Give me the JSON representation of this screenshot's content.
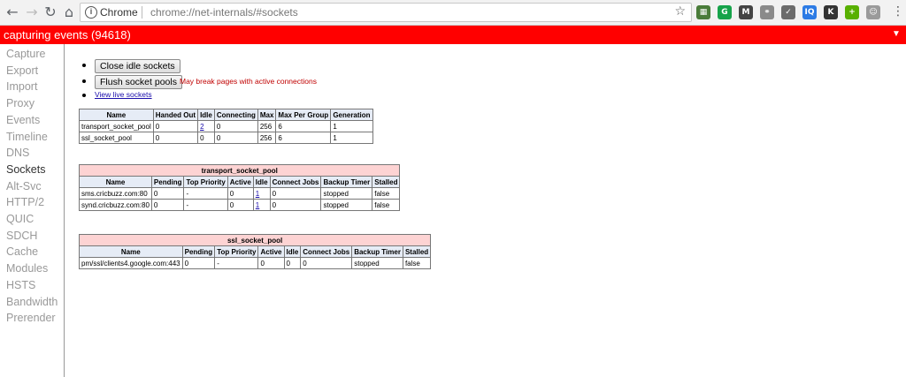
{
  "browser": {
    "omnibox_chip": "Chrome",
    "url": "chrome://net-internals/#sockets",
    "extensions": [
      {
        "name": "camera-extension-icon",
        "glyph": "▦",
        "color": "#4a7c3a"
      },
      {
        "name": "grammarly-icon",
        "glyph": "G",
        "color": "#16a34a"
      },
      {
        "name": "m-extension-icon",
        "glyph": "M",
        "color": "#444444"
      },
      {
        "name": "link-extension-icon",
        "glyph": "⚭",
        "color": "#8a8a8a"
      },
      {
        "name": "check-extension-icon",
        "glyph": "✓",
        "color": "#6b6b6b"
      },
      {
        "name": "iq-extension-icon",
        "glyph": "IQ",
        "color": "#2c7be5"
      },
      {
        "name": "k-extension-icon",
        "glyph": "K",
        "color": "#333333"
      },
      {
        "name": "plus-extension-icon",
        "glyph": "+",
        "color": "#58b000"
      },
      {
        "name": "profile-avatar-icon",
        "glyph": "☺",
        "color": "#9a9a9a"
      }
    ]
  },
  "status": {
    "text": "capturing events (94618)",
    "toggle": "▼"
  },
  "sidebar": {
    "items": [
      {
        "label": "Capture",
        "active": false
      },
      {
        "label": "Export",
        "active": false
      },
      {
        "label": "Import",
        "active": false
      },
      {
        "label": "Proxy",
        "active": false
      },
      {
        "label": "Events",
        "active": false
      },
      {
        "label": "Timeline",
        "active": false
      },
      {
        "label": "DNS",
        "active": false
      },
      {
        "label": "Sockets",
        "active": true
      },
      {
        "label": "Alt-Svc",
        "active": false
      },
      {
        "label": "HTTP/2",
        "active": false
      },
      {
        "label": "QUIC",
        "active": false
      },
      {
        "label": "SDCH",
        "active": false
      },
      {
        "label": "Cache",
        "active": false
      },
      {
        "label": "Modules",
        "active": false
      },
      {
        "label": "HSTS",
        "active": false
      },
      {
        "label": "Bandwidth",
        "active": false
      },
      {
        "label": "Prerender",
        "active": false
      }
    ]
  },
  "actions": {
    "close_idle": "Close idle sockets",
    "flush_pools": "Flush socket pools",
    "flush_warning": "May break pages with active connections",
    "view_live": "View live sockets"
  },
  "pools_table": {
    "headers": [
      "Name",
      "Handed Out",
      "Idle",
      "Connecting",
      "Max",
      "Max Per Group",
      "Generation"
    ],
    "rows": [
      [
        "transport_socket_pool",
        "0",
        "2",
        "0",
        "256",
        "6",
        "1"
      ],
      [
        "ssl_socket_pool",
        "0",
        "0",
        "0",
        "256",
        "6",
        "1"
      ]
    ],
    "link_cells": [
      [
        0,
        2
      ]
    ]
  },
  "transport_pool": {
    "title": "transport_socket_pool",
    "headers": [
      "Name",
      "Pending",
      "Top Priority",
      "Active",
      "Idle",
      "Connect Jobs",
      "Backup Timer",
      "Stalled"
    ],
    "rows": [
      [
        "sms.cricbuzz.com:80",
        "0",
        "-",
        "0",
        "1",
        "0",
        "stopped",
        "false"
      ],
      [
        "synd.cricbuzz.com:80",
        "0",
        "-",
        "0",
        "1",
        "0",
        "stopped",
        "false"
      ]
    ],
    "link_cells": [
      [
        0,
        4
      ],
      [
        1,
        4
      ]
    ]
  },
  "ssl_pool": {
    "title": "ssl_socket_pool",
    "headers": [
      "Name",
      "Pending",
      "Top Priority",
      "Active",
      "Idle",
      "Connect Jobs",
      "Backup Timer",
      "Stalled"
    ],
    "rows": [
      [
        "pm/ssl/clients4.google.com:443",
        "0",
        "-",
        "0",
        "0",
        "0",
        "stopped",
        "false"
      ]
    ],
    "link_cells": []
  }
}
